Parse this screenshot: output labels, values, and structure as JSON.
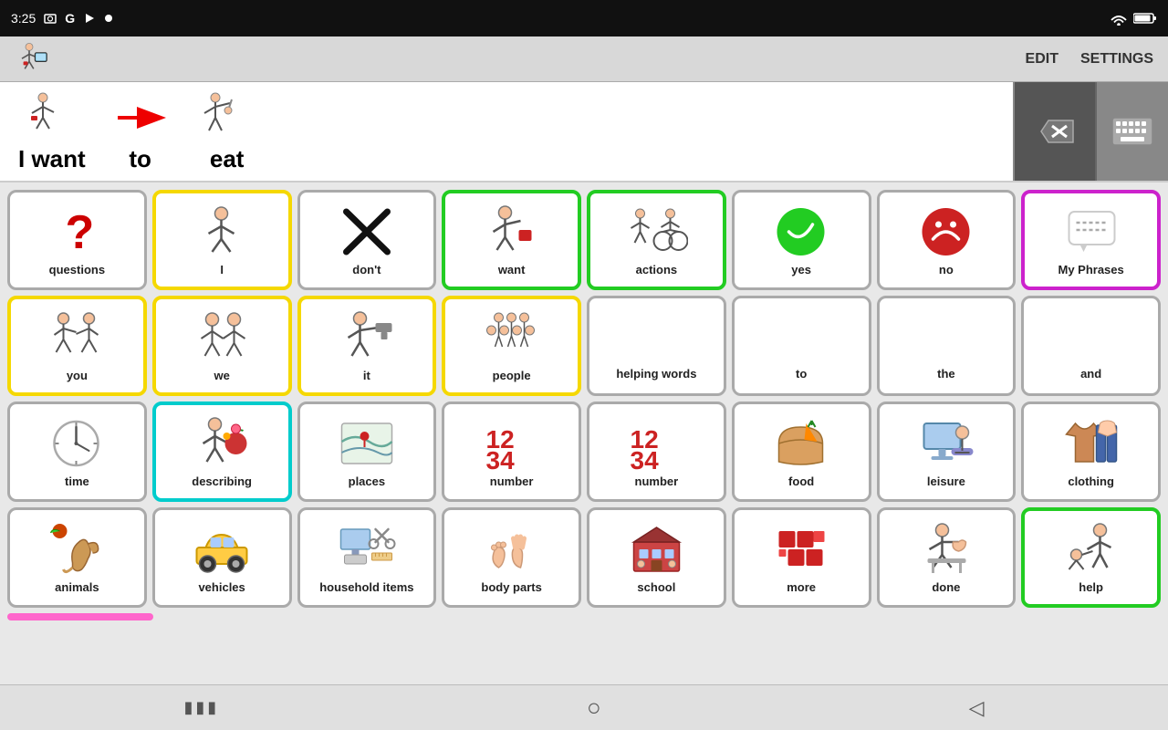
{
  "statusBar": {
    "time": "3:25",
    "icons": [
      "screenshot",
      "G",
      "play",
      "dot"
    ]
  },
  "toolbar": {
    "edit": "EDIT",
    "settings": "SETTINGS"
  },
  "sentence": [
    {
      "word": "I want",
      "icon": "person_want"
    },
    {
      "word": "to",
      "icon": "arrow"
    },
    {
      "word": "eat",
      "icon": "person_eat"
    }
  ],
  "grid": [
    {
      "label": "questions",
      "border": "gray",
      "icon": "question"
    },
    {
      "label": "I",
      "border": "yellow",
      "icon": "person_i"
    },
    {
      "label": "don't",
      "border": "gray",
      "icon": "x_mark"
    },
    {
      "label": "want",
      "border": "green",
      "icon": "person_want2"
    },
    {
      "label": "actions",
      "border": "green",
      "icon": "actions"
    },
    {
      "label": "yes",
      "border": "gray",
      "icon": "smiley_green"
    },
    {
      "label": "no",
      "border": "gray",
      "icon": "smiley_red"
    },
    {
      "label": "My Phrases",
      "border": "magenta",
      "icon": "speech_bubble"
    },
    {
      "label": "you",
      "border": "yellow",
      "icon": "person_you"
    },
    {
      "label": "we",
      "border": "yellow",
      "icon": "persons_we"
    },
    {
      "label": "it",
      "border": "yellow",
      "icon": "it_gun"
    },
    {
      "label": "people",
      "border": "yellow",
      "icon": "people_group"
    },
    {
      "label": "helping words",
      "border": "gray",
      "icon": "text_empty"
    },
    {
      "label": "to",
      "border": "gray",
      "icon": "text_empty"
    },
    {
      "label": "the",
      "border": "gray",
      "icon": "text_empty"
    },
    {
      "label": "and",
      "border": "gray",
      "icon": "text_empty"
    },
    {
      "label": "time",
      "border": "gray",
      "icon": "clock"
    },
    {
      "label": "describing",
      "border": "cyan",
      "icon": "describing"
    },
    {
      "label": "places",
      "border": "gray",
      "icon": "places"
    },
    {
      "label": "number",
      "border": "gray",
      "icon": "numbers1"
    },
    {
      "label": "number",
      "border": "gray",
      "icon": "numbers2"
    },
    {
      "label": "food",
      "border": "gray",
      "icon": "food"
    },
    {
      "label": "leisure",
      "border": "gray",
      "icon": "leisure"
    },
    {
      "label": "clothing",
      "border": "gray",
      "icon": "clothing"
    },
    {
      "label": "animals",
      "border": "gray",
      "icon": "animals"
    },
    {
      "label": "vehicles",
      "border": "gray",
      "icon": "vehicles"
    },
    {
      "label": "household items",
      "border": "gray",
      "icon": "household"
    },
    {
      "label": "body parts",
      "border": "gray",
      "icon": "body_parts"
    },
    {
      "label": "school",
      "border": "gray",
      "icon": "school"
    },
    {
      "label": "more",
      "border": "gray",
      "icon": "more_blocks"
    },
    {
      "label": "done",
      "border": "gray",
      "icon": "done_hand"
    },
    {
      "label": "help",
      "border": "green",
      "icon": "help_figure"
    }
  ],
  "bottomNav": {
    "back": "◁",
    "home": "○",
    "recent": "▮▮▮"
  }
}
